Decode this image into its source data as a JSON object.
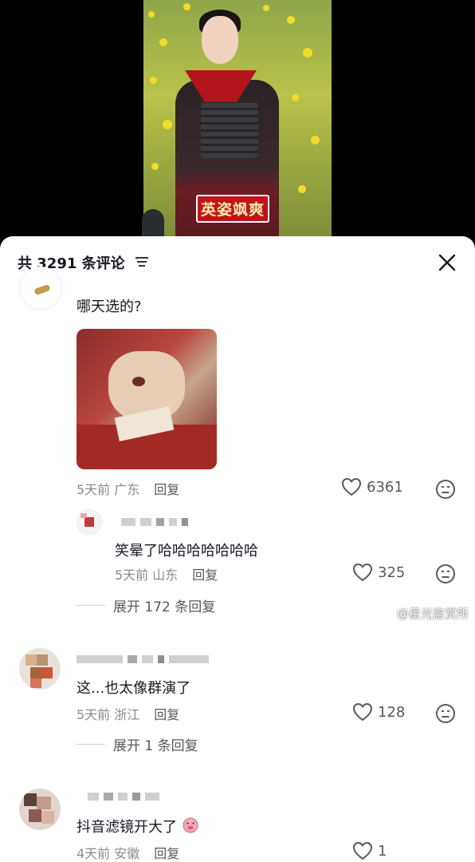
{
  "video": {
    "caption": "英姿飒爽"
  },
  "sheet": {
    "title": "共 3291 条评论",
    "filter_icon": "filter-icon",
    "close_icon": "close-icon"
  },
  "comments": [
    {
      "text": "哪天选的?",
      "date": "5天前",
      "location": "广东",
      "reply_label": "回复",
      "likes": "6361"
    },
    {
      "text": "这...也太像群演了",
      "date": "5天前",
      "location": "浙江",
      "reply_label": "回复",
      "likes": "128",
      "expand_label": "展开 1 条回复"
    },
    {
      "text": "抖音滤镜开大了",
      "date": "4天前",
      "location": "安徽",
      "reply_label": "回复",
      "likes": "1"
    }
  ],
  "reply": {
    "text": "笑晕了哈哈哈哈哈哈哈",
    "date": "5天前",
    "location": "山东",
    "reply_label": "回复",
    "likes": "325"
  },
  "expand_first": {
    "label": "展开 172 条回复"
  },
  "watermark": "@星光鉴赏所",
  "colors": {
    "primary_text": "#161823",
    "meta": "#8a8b91",
    "caption_bg": "#c2121b"
  }
}
